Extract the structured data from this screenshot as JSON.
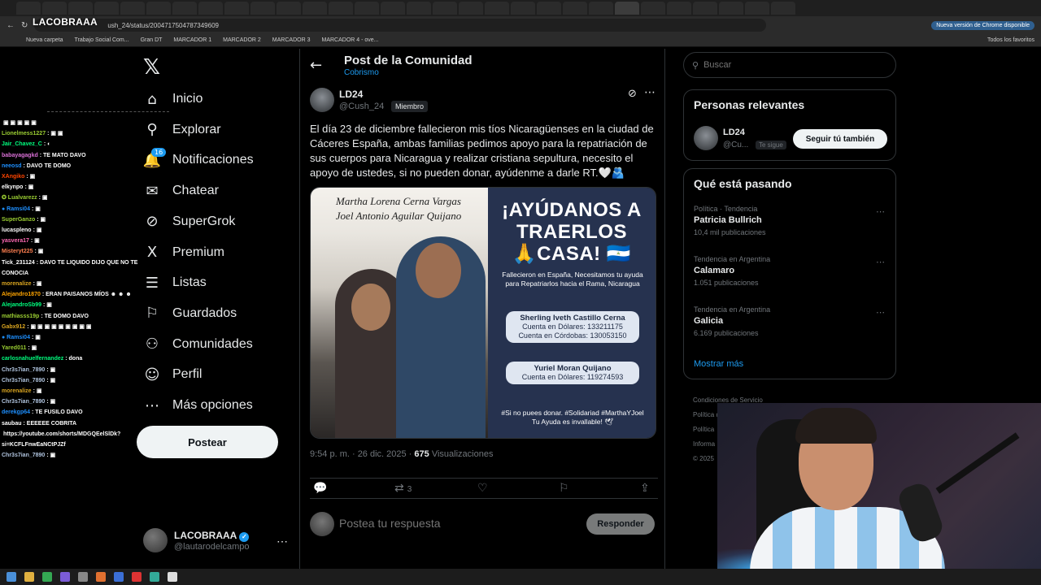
{
  "browser": {
    "url": "ush_24/status/2004717504787349609",
    "update_label": "Nueva versión de Chrome disponible",
    "bookmarks": [
      "Nueva carpeta",
      "Trabajo Social Com...",
      "Gran DT",
      "MARCADOR 1",
      "MARCADOR 2",
      "MARCADOR 3",
      "MARCADOR 4 - ove..."
    ],
    "bookmarks_right": "Todos los favoritos"
  },
  "stream": {
    "logo": "LACOBRAAA",
    "chat": [
      {
        "user": "",
        "text": "▣ ▣ ▣ ▣ ▣",
        "color": "#cccccc"
      },
      {
        "user": "Lionelmess1227",
        "text": ": ▣ ▣",
        "color": "#9acd32"
      },
      {
        "user": "Jair_Chavez_C",
        "text": ": ◐",
        "color": "#00ff7f"
      },
      {
        "user": "babayagagkd",
        "text": ": TE MATO DAVO",
        "color": "#da70d6"
      },
      {
        "user": "neeosd",
        "text": ": DAVO TE DOMO",
        "color": "#1e90ff"
      },
      {
        "user": "XAngiko",
        "text": ": ▣",
        "color": "#ff4500"
      },
      {
        "user": "elkynpo",
        "text": ": ▣",
        "color": "#ffffff"
      },
      {
        "user": "✪ Lualvarezz",
        "text": ": ▣",
        "color": "#9acd32"
      },
      {
        "user": "● Ramsi04",
        "text": ": ▣",
        "color": "#1e90ff"
      },
      {
        "user": "SuperGanzo",
        "text": ": ▣",
        "color": "#9acd32"
      },
      {
        "user": "lucaspleno",
        "text": ": ▣",
        "color": "#ffffff"
      },
      {
        "user": "yasvera17",
        "text": ": ▣",
        "color": "#ff69b4"
      },
      {
        "user": "Misteryt225",
        "text": ": ▣",
        "color": "#ff7f50"
      },
      {
        "user": "Tick_231124",
        "text": ": DAVO TE LIQUIDO DIJO QUE NO TE CONOCIA",
        "color": "#ffffff"
      },
      {
        "user": "morenalize",
        "text": ": ▣",
        "color": "#daa520"
      },
      {
        "user": "Alejandro1870",
        "text": ": ERAN PAISANOS MÍOS ☻ ☻ ☻",
        "color": "#ffa500"
      },
      {
        "user": "AlejandroSb99",
        "text": ": ▣",
        "color": "#00ff7f"
      },
      {
        "user": "mathiasss19p",
        "text": ": TE DOMO DAVO",
        "color": "#9acd32"
      },
      {
        "user": "Gabx912",
        "text": ": ▣ ▣ ▣ ▣ ▣ ▣ ▣ ▣ ▣",
        "color": "#daa520"
      },
      {
        "user": "● Ramsi04",
        "text": ": ▣",
        "color": "#1e90ff"
      },
      {
        "user": "Yared011",
        "text": ": ▣",
        "color": "#9acd32"
      },
      {
        "user": "carlosnahuelfernandez",
        "text": ": dona",
        "color": "#00ff7f"
      },
      {
        "user": "Chr3s7ian_7890",
        "text": ": ▣",
        "color": "#b0c4de"
      },
      {
        "user": "Chr3s7ian_7890",
        "text": ": ▣",
        "color": "#b0c4de"
      },
      {
        "user": "morenalize",
        "text": ": ▣",
        "color": "#daa520"
      },
      {
        "user": "Chr3s7ian_7890",
        "text": ": ▣",
        "color": "#b0c4de"
      },
      {
        "user": "derekgp64",
        "text": ": TE FUSILO DAVO",
        "color": "#1e90ff"
      },
      {
        "user": "saubau",
        "text": ": EEEEEE COBRITA",
        "color": "#ffffff"
      },
      {
        "user": "",
        "text": "https://youtube.com/shorts/MDGQEelSlDk?si=KCFLFnwEaNCtPJZf",
        "color": "#ffffff"
      },
      {
        "user": "Chr3s7ian_7890",
        "text": ": ▣",
        "color": "#b0c4de"
      }
    ]
  },
  "nav": {
    "items": [
      {
        "label": "Inicio",
        "icon": "⌂",
        "name": "home"
      },
      {
        "label": "Explorar",
        "icon": "⚲",
        "name": "explore"
      },
      {
        "label": "Notificaciones",
        "icon": "🔔",
        "name": "notifications"
      },
      {
        "label": "Chatear",
        "icon": "✉",
        "name": "chat"
      },
      {
        "label": "SuperGrok",
        "icon": "⊘",
        "name": "supergrok"
      },
      {
        "label": "Premium",
        "icon": "X",
        "name": "premium"
      },
      {
        "label": "Listas",
        "icon": "☰",
        "name": "lists"
      },
      {
        "label": "Guardados",
        "icon": "⚐",
        "name": "bookmarks"
      },
      {
        "label": "Comunidades",
        "icon": "⚇",
        "name": "communities"
      },
      {
        "label": "Perfil",
        "icon": "☺",
        "name": "profile"
      },
      {
        "label": "Más opciones",
        "icon": "⋯",
        "name": "more"
      }
    ],
    "notif_badge": "16",
    "post_label": "Postear",
    "account": {
      "name": "LACOBRAAA",
      "handle": "@lautarodelcampo"
    }
  },
  "post": {
    "header_title": "Post de la Comunidad",
    "header_sub": "Cobrismo",
    "author_name": "LD24",
    "author_handle": "@Cush_24",
    "member_badge": "Miembro",
    "text": "El día 23 de diciembre fallecieron mis tíos Nicaragüenses en la ciudad de Cáceres España, ambas familias pedimos apoyo para la repatriación de sus cuerpos para Nicaragua y realizar cristiana sepultura, necesito el apoyo de ustedes, si no pueden donar, ayúdenme a darle RT.🤍🫂",
    "image": {
      "names_line1": "Martha Lorena Cerna Vargas",
      "names_line2": "Joel Antonio Aguilar Quijano",
      "headline1": "¡AYÚDANOS A",
      "headline2": "TRAERLOS",
      "headline3": "🙏CASA! 🇳🇮",
      "info": "Fallecieron en España, Necesitamos tu ayuda para Repatriarlos hacia el Rama, Nicaragua",
      "card1_name": "Sherling Iveth Castillo Cerna",
      "card1_line1": "Cuenta en Dólares: 133211175",
      "card1_line2": "Cuenta en Córdobas: 130053150",
      "card2_name": "Yuriel Moran Quijano",
      "card2_line1": "Cuenta en Dólares: 119274593",
      "footer1": "#Si no puees donar. #Solidariad #MarthaYJoel",
      "footer2": "Tu Ayuda es invallable! 🕊"
    },
    "time": "9:54 p. m. · 26 dic. 2025 · ",
    "views_count": "675",
    "views_label": " Visualizaciones",
    "retweets": "3",
    "reply_placeholder": "Postea tu respuesta",
    "reply_button": "Responder"
  },
  "sidebar": {
    "search_placeholder": "Buscar",
    "relevant_title": "Personas relevantes",
    "relevant_name": "LD24",
    "relevant_handle": "@Cu...",
    "relevant_follows": "Te sigue",
    "follow_button": "Seguir tú también",
    "trending_title": "Qué está pasando",
    "trends": [
      {
        "category": "Política · Tendencia",
        "name": "Patricia Bullrich",
        "count": "10,4 mil publicaciones"
      },
      {
        "category": "Tendencia en Argentina",
        "name": "Calamaro",
        "count": "1.051 publicaciones"
      },
      {
        "category": "Tendencia en Argentina",
        "name": "Galicia",
        "count": "6.169 publicaciones"
      }
    ],
    "show_more": "Mostrar más",
    "footer": [
      "Condiciones de Servicio",
      "Política de Privacidad",
      "Política",
      "Informa",
      "© 2025"
    ]
  }
}
